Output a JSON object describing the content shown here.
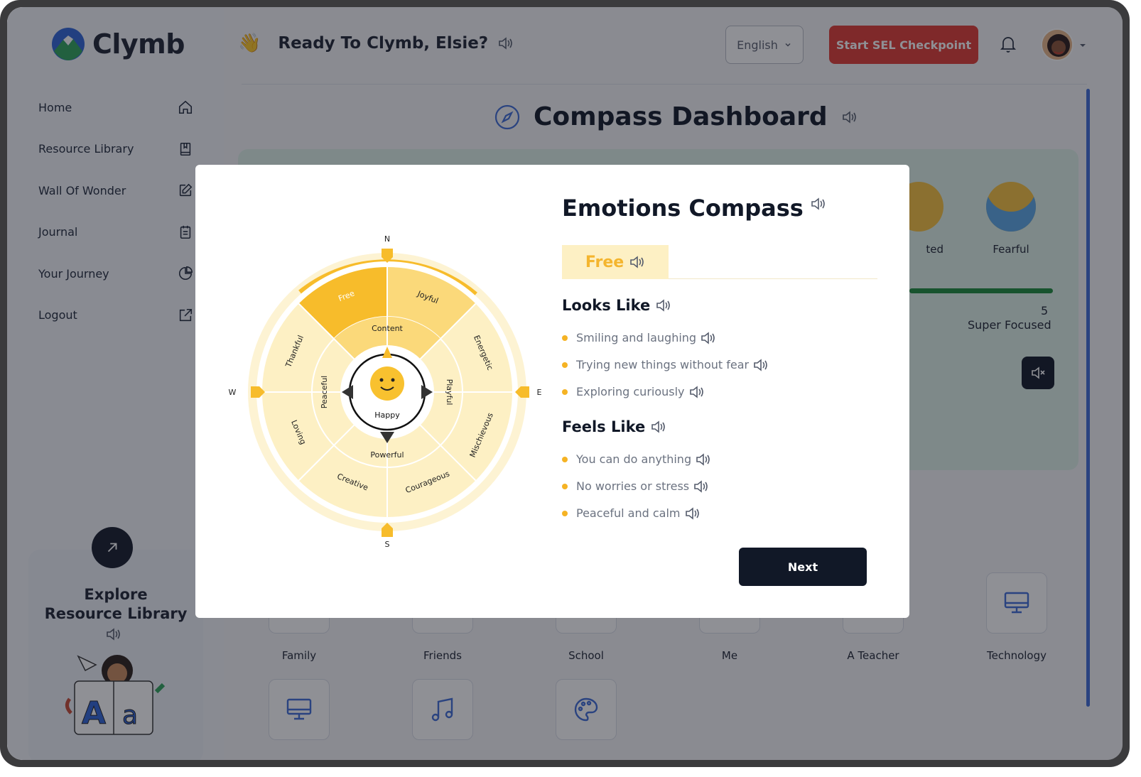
{
  "app": {
    "name": "Clymb"
  },
  "sidebar": {
    "items": [
      {
        "label": "Home",
        "icon": "home-icon"
      },
      {
        "label": "Resource Library",
        "icon": "book-icon"
      },
      {
        "label": "Wall Of Wonder",
        "icon": "edit-icon"
      },
      {
        "label": "Journal",
        "icon": "journal-icon"
      },
      {
        "label": "Your Journey",
        "icon": "pie-chart-icon"
      },
      {
        "label": "Logout",
        "icon": "external-link-icon"
      }
    ],
    "explore": {
      "title_line1": "Explore",
      "title_line2": "Resource Library"
    }
  },
  "header": {
    "greeting": "Ready To Clymb, Elsie?",
    "language": "English",
    "cta": "Start SEL Checkpoint"
  },
  "dashboard": {
    "title": "Compass Dashboard",
    "emotions": [
      {
        "label": "ted"
      },
      {
        "label": "Fearful"
      }
    ],
    "focus": {
      "value": "5",
      "label": "Super Focused"
    },
    "topics": [
      {
        "label": "Family"
      },
      {
        "label": "Friends"
      },
      {
        "label": "School"
      },
      {
        "label": "Me"
      },
      {
        "label": "A Teacher"
      },
      {
        "label": "Technology"
      }
    ]
  },
  "modal": {
    "title": "Emotions Compass",
    "tab": "Free",
    "looks_like_title": "Looks Like",
    "looks_like": [
      "Smiling and laughing",
      "Trying new things without fear",
      "Exploring curiously"
    ],
    "feels_like_title": "Feels Like",
    "feels_like": [
      "You can do anything",
      "No worries or stress",
      "Peaceful and calm"
    ],
    "next": "Next",
    "compass": {
      "directions": {
        "n": "N",
        "e": "E",
        "s": "S",
        "w": "W"
      },
      "center": "Happy",
      "inner": [
        "Content",
        "Playful",
        "Powerful",
        "Peaceful"
      ],
      "outer": [
        "Free",
        "Joyful",
        "Energetic",
        "Mischievous",
        "Courageous",
        "Creative",
        "Loving",
        "Thankful"
      ],
      "selected": "Free"
    }
  },
  "colors": {
    "accent": "#e03a33",
    "compass_selected": "#f7bc2b",
    "compass_light": "#fdf0c4",
    "dark": "#111827"
  }
}
